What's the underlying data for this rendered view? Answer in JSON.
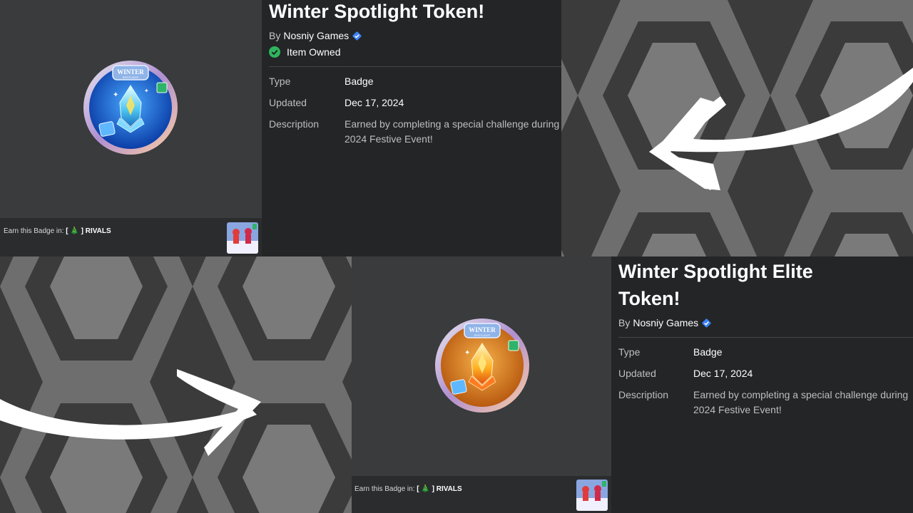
{
  "top": {
    "title": "Winter Spotlight Token!",
    "by_label": "By",
    "creator": "Nosniy Games",
    "owned_label": "Item Owned",
    "type_label": "Type",
    "type_value": "Badge",
    "updated_label": "Updated",
    "updated_value": "Dec 17, 2024",
    "description_label": "Description",
    "description_line1": "Earned by completing a special challenge during",
    "description_line2": "2024 Festive Event!",
    "earn_prefix": "Earn this Badge in:",
    "earn_game": "[ 🎄 ] RIVALS",
    "badge_text": "WINTER",
    "badge_subtext": "SPOTLIGHT",
    "badge_color": "#1f6fd6"
  },
  "bottom": {
    "title_line1": "Winter Spotlight Elite",
    "title_line2": "Token!",
    "by_label": "By",
    "creator": "Nosniy Games",
    "type_label": "Type",
    "type_value": "Badge",
    "updated_label": "Updated",
    "updated_value": "Dec 17, 2024",
    "description_label": "Description",
    "description_line1": "Earned by completing a special challenge during",
    "description_line2": "2024 Festive Event!",
    "earn_prefix": "Earn this Badge in:",
    "earn_game": "[ 🎄 ] RIVALS",
    "badge_text": "WINTER",
    "badge_subtext": "SPOTLIGHT",
    "badge_color": "#e0801f"
  },
  "colors": {
    "verified": "#3b82f6",
    "owned": "#2fb55e",
    "panel_bg": "#232527",
    "image_bg": "#393b3d"
  },
  "icons": {
    "verified": "verified-badge-icon",
    "owned": "check-circle-icon",
    "arrow_top": "curved-arrow-left-icon",
    "arrow_bottom": "curved-arrow-right-icon"
  }
}
